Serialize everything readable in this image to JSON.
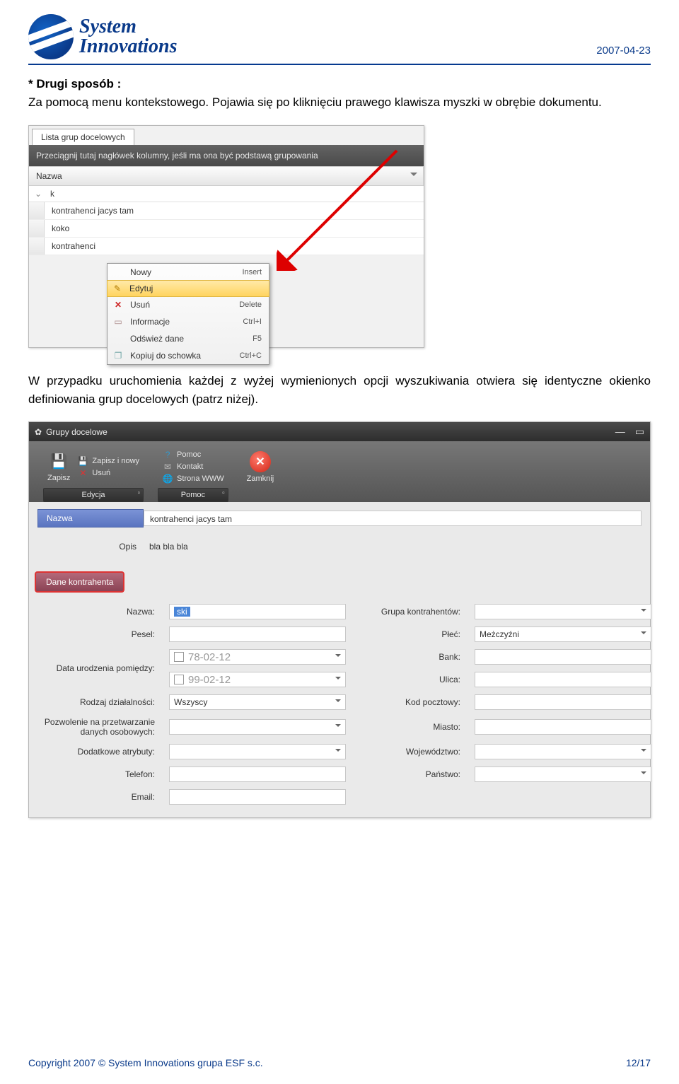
{
  "header": {
    "brand_line1": "System",
    "brand_line2": "Innovations",
    "date": "2007-04-23"
  },
  "para1_bold": "* Drugi sposób :",
  "para1_rest": "Za pomocą menu kontekstowego. Pojawia się po kliknięciu prawego klawisza myszki w obrębie dokumentu.",
  "shot1": {
    "tab": "Lista grup docelowych",
    "dragbar": "Przeciągnij tutaj nagłówek kolumny, jeśli ma ona być podstawą grupowania",
    "col": "Nazwa",
    "filter": "k",
    "rows": [
      "kontrahenci jacys tam",
      "koko",
      "kontrahenci"
    ],
    "menu": [
      {
        "icon": "",
        "label": "Nowy",
        "shortcut": "Insert",
        "hl": false
      },
      {
        "icon": "edit",
        "label": "Edytuj",
        "shortcut": "",
        "hl": true
      },
      {
        "icon": "x",
        "label": "Usuń",
        "shortcut": "Delete",
        "hl": false
      },
      {
        "icon": "info",
        "label": "Informacje",
        "shortcut": "Ctrl+I",
        "hl": false
      },
      {
        "icon": "",
        "label": "Odśwież dane",
        "shortcut": "F5",
        "hl": false
      },
      {
        "icon": "copy",
        "label": "Kopiuj do schowka",
        "shortcut": "Ctrl+C",
        "hl": false
      }
    ]
  },
  "para2": "W przypadku uruchomienia każdej z wyżej wymienionych opcji wyszukiwania otwiera się identyczne okienko definiowania grup docelowych (patrz niżej).",
  "shot2": {
    "title": "Grupy docelowe",
    "ribbon": {
      "save": "Zapisz",
      "save_new": "Zapisz i nowy",
      "delete": "Usuń",
      "group_edit": "Edycja",
      "help": "Pomoc",
      "contact": "Kontakt",
      "www": "Strona WWW",
      "group_help": "Pomoc",
      "close": "Zamknij"
    },
    "top": {
      "nazwa_label": "Nazwa",
      "nazwa_value": "kontrahenci jacys tam",
      "opis_label": "Opis",
      "opis_value": "bla bla bla"
    },
    "section": "Dane kontrahenta",
    "fields": {
      "nazwa": {
        "label": "Nazwa:",
        "value": "ski"
      },
      "pesel": {
        "label": "Pesel:",
        "value": ""
      },
      "data_ur": {
        "label": "Data urodzenia pomiędzy:",
        "v1": "78-02-12",
        "v2": "99-02-12"
      },
      "rodzaj": {
        "label": "Rodzaj działalności:",
        "value": "Wszyscy"
      },
      "pozw": {
        "label": "Pozwolenie na przetwarzanie danych osobowych:",
        "value": ""
      },
      "dod": {
        "label": "Dodatkowe atrybuty:",
        "value": ""
      },
      "tel": {
        "label": "Telefon:",
        "value": ""
      },
      "email": {
        "label": "Email:",
        "value": ""
      },
      "grupa": {
        "label": "Grupa kontrahentów:",
        "value": ""
      },
      "plec": {
        "label": "Płeć:",
        "value": "Meżczyźni"
      },
      "bank": {
        "label": "Bank:",
        "value": ""
      },
      "ulica": {
        "label": "Ulica:",
        "value": ""
      },
      "kod": {
        "label": "Kod pocztowy:",
        "value": ""
      },
      "miasto": {
        "label": "Miasto:",
        "value": ""
      },
      "woj": {
        "label": "Województwo:",
        "value": ""
      },
      "panstwo": {
        "label": "Państwo:",
        "value": ""
      }
    }
  },
  "footer": {
    "copyright": "Copyright 2007 © System Innovations grupa ESF s.c.",
    "page": "12/17"
  }
}
